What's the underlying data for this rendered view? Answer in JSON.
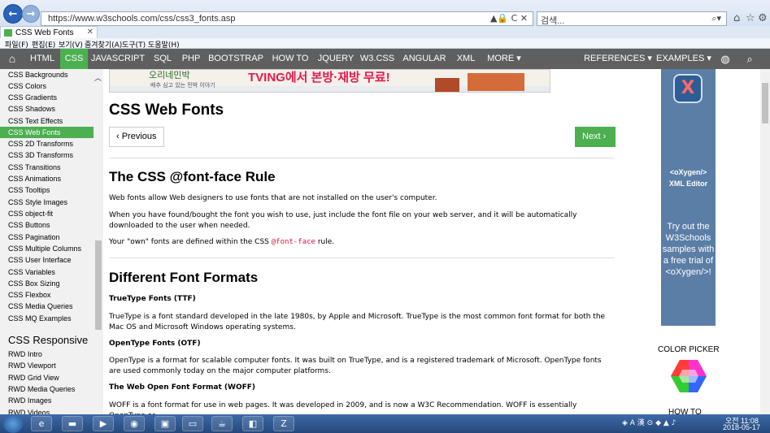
{
  "browser": {
    "url": "https://www.w3schools.com/css/css3_fonts.asp",
    "addr_tools": "▲🔒 C ✕",
    "search_text": "검색...",
    "search_icon": "magnifier-icon",
    "tab_label": "CSS Web Fonts",
    "tab_close": "✕",
    "menu": [
      "파일(F)",
      "편집(E)",
      "보기(V)",
      "즐겨찾기(A)",
      "도구(T)",
      "도움말(H)"
    ]
  },
  "topnav": {
    "home_icon": "home-icon",
    "items": [
      "HTML",
      "CSS",
      "JAVASCRIPT",
      "SQL",
      "PHP",
      "BOOTSTRAP",
      "HOW TO",
      "JQUERY",
      "W3.CSS",
      "ANGULAR",
      "XML",
      "MORE ▾"
    ],
    "right": [
      "REFERENCES ▾",
      "EXAMPLES ▾"
    ],
    "active": "CSS"
  },
  "sidebar": {
    "items": [
      "CSS Backgrounds",
      "CSS Colors",
      "CSS Gradients",
      "CSS Shadows",
      "CSS Text Effects",
      "CSS Web Fonts",
      "CSS 2D Transforms",
      "CSS 3D Transforms",
      "CSS Transitions",
      "CSS Animations",
      "CSS Tooltips",
      "CSS Style Images",
      "CSS object-fit",
      "CSS Buttons",
      "CSS Pagination",
      "CSS Multiple Columns",
      "CSS User Interface",
      "CSS Variables",
      "CSS Box Sizing",
      "CSS Flexbox",
      "CSS Media Queries",
      "CSS MQ Examples"
    ],
    "active": "CSS Web Fonts",
    "section_heading": "CSS Responsive",
    "responsive_items": [
      "RWD Intro",
      "RWD Viewport",
      "RWD Grid View",
      "RWD Media Queries",
      "RWD Images",
      "RWD Videos"
    ]
  },
  "banner": {
    "logo_text": "오리네민박",
    "sub_text": "배추 심고 있는 민박 이야기",
    "text": "TVING에서 본방·재방 무료!"
  },
  "content": {
    "title": "CSS Web Fonts",
    "prev_label": "‹ Previous",
    "next_label": "Next ›",
    "h2_fontface": "The CSS @font-face Rule",
    "p1": "Web fonts allow Web designers to use fonts that are not installed on the user's computer.",
    "p2": "When you have found/bought the font you wish to use, just include the font file on your web server, and it will be automatically downloaded to the user when needed.",
    "p3_before": "Your \"own\" fonts are defined within the CSS ",
    "p3_code": "@font-face",
    "p3_after": " rule.",
    "h2_formats": "Different Font Formats",
    "ttf_heading": "TrueType Fonts (TTF)",
    "ttf_text": "TrueType is a font standard developed in the late 1980s, by Apple and Microsoft. TrueType is the most common font format for both the Mac OS and Microsoft Windows operating systems.",
    "otf_heading": "OpenType Fonts (OTF)",
    "otf_text": "OpenType is a format for scalable computer fonts. It was built on TrueType, and is a registered trademark of Microsoft. OpenType fonts are used commonly today on the major computer platforms.",
    "woff_heading": "The Web Open Font Format (WOFF)",
    "woff_text": "WOFF is a font format for use in web pages. It was developed in 2009, and is now a W3C Recommendation. WOFF is essentially OpenType or"
  },
  "ad": {
    "logo": "X",
    "brand": "<oXygen/>",
    "product": "XML Editor",
    "tagline": "Try out the W3Schools samples with a free trial of <oXygen/>!"
  },
  "right": {
    "color_picker": "COLOR PICKER",
    "howto": "HOW TO"
  },
  "taskbar": {
    "apps": [
      "ie-icon",
      "folder-icon",
      "media-icon",
      "chrome-icon",
      "app-icon",
      "cmd-icon",
      "java-icon",
      "vscode-icon",
      "filezilla-icon"
    ],
    "tray_text": "◈ A 漢 ⊙ ◆ ▲ ♪",
    "time": "오전 11:08",
    "date": "2018-05-17"
  },
  "colors": {
    "accent": "#4caf50",
    "topnav_bg": "#5f5f5f",
    "code": "#dc143c",
    "ad_bg": "#5b7ea6"
  }
}
